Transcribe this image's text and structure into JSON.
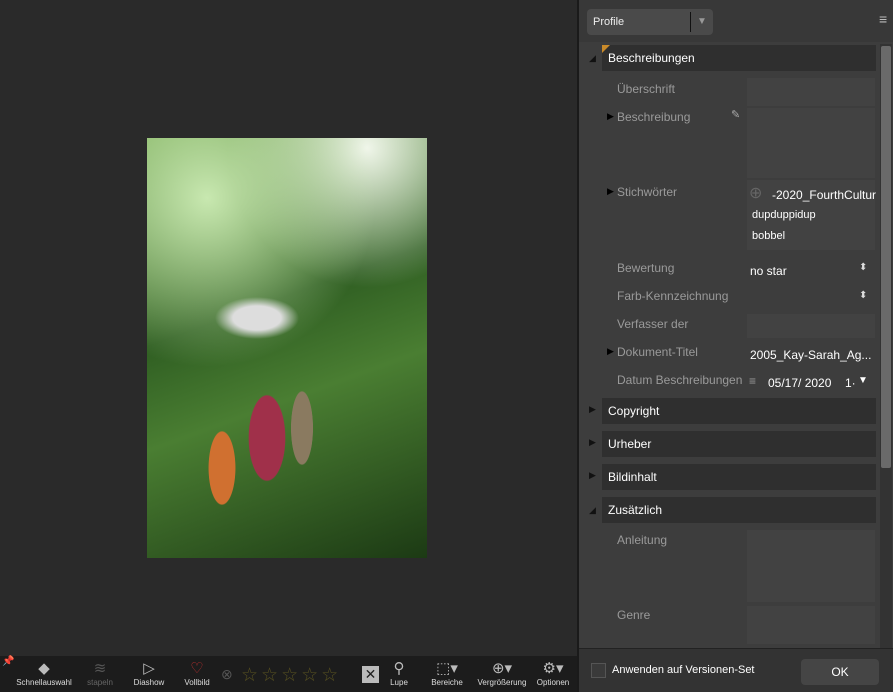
{
  "toolbar": {
    "items": [
      {
        "label": "Schnellauswahl",
        "icon": "quick-select-icon"
      },
      {
        "label": "stapeln",
        "icon": "stack-icon"
      },
      {
        "label": "Diashow",
        "icon": "slideshow-icon"
      },
      {
        "label": "Vollbild",
        "icon": "fullscreen-icon"
      },
      {
        "label": "Lupe",
        "icon": "loupe-icon"
      },
      {
        "label": "Bereiche",
        "icon": "regions-icon"
      },
      {
        "label": "Vergrößerung",
        "icon": "zoom-icon"
      },
      {
        "label": "Optionen",
        "icon": "gear-icon"
      }
    ],
    "rating_stars": 0,
    "star_count": 5
  },
  "panel": {
    "profile": "Profile",
    "sections": {
      "beschreibungen": "Beschreibungen",
      "copyright": "Copyright",
      "urheber": "Urheber",
      "bildinhalt": "Bildinhalt",
      "zusaetzlich": "Zusätzlich"
    },
    "fields": {
      "ueberschrift": "Überschrift",
      "beschreibung": "Beschreibung",
      "stichwoerter": "Stichwörter",
      "keywords": [
        "-2020_FourthCultur",
        "dupduppidup",
        "bobbel"
      ],
      "bewertung": "Bewertung",
      "bewertung_value": "no star",
      "farb": "Farb-Kennzeichnung",
      "verfasser": "Verfasser der",
      "dokument_titel": "Dokument-Titel",
      "dokument_titel_value": "2005_Kay-Sarah_Ag...",
      "datum": "Datum Beschreibungen",
      "datum_value": "05/17/ 2020",
      "datum_time": "1·",
      "anleitung": "Anleitung",
      "genre": "Genre"
    },
    "apply_label": "Anwenden auf Versionen-Set",
    "ok_label": "OK"
  }
}
